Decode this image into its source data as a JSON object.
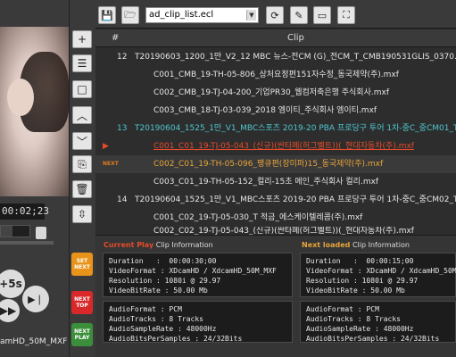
{
  "preview": {
    "timecode": "00:02;23",
    "slider_fraction": 0.4,
    "skip_label": "+5s",
    "format_label": "amHD_50M_MXF"
  },
  "toolbar": {
    "file_name": "ad_clip_list.ecl"
  },
  "list": {
    "col_num": "#",
    "col_clip": "Clip",
    "next_marker": "NEXT",
    "rows": [
      {
        "num": "12",
        "text": "T20190603_1200_1만_V2_12 MBC 뉴스-전CM (G)_전CM_T_CMB190531GLIS_0370.xml"
      },
      {
        "num": "",
        "text": "C001_CMB_19-TH-05-806_상처요정편151자수정_동국제약(주).mxf"
      },
      {
        "num": "",
        "text": "C002_CMB_19-TJ-04-200_기업PR30_웹컴저축은행 주식회사.mxf"
      },
      {
        "num": "",
        "text": "C003_CMB_18-TJ-03-039_2018 엠이티_주식회사 엠이티.mxf"
      },
      {
        "num": "13",
        "text": "T20190604_1525_1만_V1_MBC스포츠 2019-20 PBA 프로당구 투어 1차-중C_중CM01_T_CC"
      },
      {
        "num": "",
        "text": "C001_C01_19-TJ-05-043_(신규)(싼타페(허그벨트))(_현대자동차(주).mxf"
      },
      {
        "num": "",
        "text": "C002_C01_19-TH-05-096_팽큐편(장미퍼)15_동국제약(주).mxf"
      },
      {
        "num": "",
        "text": "C003_C01_19-TH-05-152_컬리-15초 메인_주식회사 컬리.mxf"
      },
      {
        "num": "14",
        "text": "T20190604_1525_1만_V1_MBC스포츠 2019-20 PBA 프로당구 투어 1차-중C_중CM02_T_CC"
      },
      {
        "num": "",
        "text": "C001_C02_19-TJ-05-030_T 적금_에스케이텔레콤(주).mxf"
      },
      {
        "num": "",
        "text": "C002_C02_19-TJ-05-043_(신규)(싼타페(허그벨트))(_현대자동차(주).mxf"
      }
    ]
  },
  "current_info": {
    "title_hl": "Current Play",
    "title_rest": " Clip Information",
    "video": "Duration   :  00:00:30;00\nVideoFormat : XDcamHD / XdcamHD_50M_MXF\nResolution : 1080i @ 29.97\nVideoBitRate : 50.00 Mb",
    "audio": "AudioFormat : PCM\nAudioTracks : 8 Tracks\nAudioSampleRate : 48000Hz\nAudioBitsPerSamples : 24/32Bits"
  },
  "next_info": {
    "title_hl": "Next loaded",
    "title_rest": " Clip Information",
    "video": "Duration   :  00:00:15;00\nVideoFormat : XDcamHD / XdcamHD_50M_MXF\nResolution : 1080i @ 29.97\nVideoBitRate : 50.00 Mb",
    "audio": "AudioFormat : PCM\nAudioTracks : 8 Tracks\nAudioSampleRate : 48000Hz\nAudioBitsPerSamples : 24/32Bits"
  },
  "side_buttons": {
    "set_next": "SET NEXT",
    "next_top": "NEXT TOP",
    "next_play": "NEXT PLAY"
  },
  "colors": {
    "current_title": "#e84b2a",
    "next_title": "#e8a43b",
    "set_next_bg": "#e8941a",
    "next_top_bg": "#d8282a",
    "next_play_bg": "#3b8f3b"
  }
}
